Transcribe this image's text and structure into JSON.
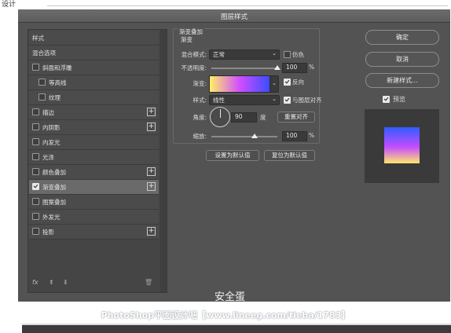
{
  "top_fragment": "设计",
  "window": {
    "title": "图层样式"
  },
  "left_panel": {
    "items": [
      {
        "label": "样式",
        "has_checkbox": false,
        "checked": false,
        "indent": 0,
        "has_plus": false,
        "selected": false
      },
      {
        "label": "混合选项",
        "has_checkbox": false,
        "checked": false,
        "indent": 0,
        "has_plus": false,
        "selected": false
      },
      {
        "label": "斜面和浮雕",
        "has_checkbox": true,
        "checked": false,
        "indent": 0,
        "has_plus": false,
        "selected": false
      },
      {
        "label": "等高线",
        "has_checkbox": true,
        "checked": false,
        "indent": 1,
        "has_plus": false,
        "selected": false
      },
      {
        "label": "纹理",
        "has_checkbox": true,
        "checked": false,
        "indent": 1,
        "has_plus": false,
        "selected": false
      },
      {
        "label": "描边",
        "has_checkbox": true,
        "checked": false,
        "indent": 0,
        "has_plus": true,
        "selected": false
      },
      {
        "label": "内阴影",
        "has_checkbox": true,
        "checked": false,
        "indent": 0,
        "has_plus": true,
        "selected": false
      },
      {
        "label": "内发光",
        "has_checkbox": true,
        "checked": false,
        "indent": 0,
        "has_plus": false,
        "selected": false
      },
      {
        "label": "光泽",
        "has_checkbox": true,
        "checked": false,
        "indent": 0,
        "has_plus": false,
        "selected": false
      },
      {
        "label": "颜色叠加",
        "has_checkbox": true,
        "checked": false,
        "indent": 0,
        "has_plus": true,
        "selected": false
      },
      {
        "label": "渐变叠加",
        "has_checkbox": true,
        "checked": true,
        "indent": 0,
        "has_plus": true,
        "selected": true
      },
      {
        "label": "图案叠加",
        "has_checkbox": true,
        "checked": false,
        "indent": 0,
        "has_plus": false,
        "selected": false
      },
      {
        "label": "外发光",
        "has_checkbox": true,
        "checked": false,
        "indent": 0,
        "has_plus": false,
        "selected": false
      },
      {
        "label": "投影",
        "has_checkbox": true,
        "checked": false,
        "indent": 0,
        "has_plus": true,
        "selected": false
      }
    ],
    "footer": {
      "fx": "fx",
      "up": "⬆",
      "down": "⬇",
      "trash": "🗑"
    }
  },
  "gradient_overlay": {
    "section_title": "渐变叠加",
    "section_subtitle": "渐变",
    "blend_mode_label": "混合模式:",
    "blend_mode_value": "正常",
    "dither_label": "仿色",
    "dither_checked": false,
    "opacity_label": "不透明度:",
    "opacity_value": "100",
    "opacity_unit": "%",
    "opacity_level": 1.0,
    "gradient_label": "渐变:",
    "reverse_label": "反向",
    "reverse_checked": true,
    "style_label": "样式:",
    "style_value": "线性",
    "align_label": "与图层对齐",
    "align_checked": true,
    "angle_label": "角度:",
    "angle_value": "90",
    "angle_unit": "度",
    "reset_align_label": "重置对齐",
    "scale_label": "缩放:",
    "scale_value": "100",
    "scale_unit": "%",
    "scale_level": 0.66,
    "set_default_label": "设置为默认值",
    "reset_default_label": "复位为默认值",
    "gradient_colors": [
      "#fff066",
      "#d24dff",
      "#3a4dff"
    ]
  },
  "right_panel": {
    "ok_label": "确定",
    "cancel_label": "取消",
    "new_style_label": "新建样式...",
    "preview_label": "预览",
    "preview_checked": true
  },
  "watermark": "安全蛋",
  "credit": "PhotoShop平面设计吧【www.lineeg.com/tieba/1783】"
}
